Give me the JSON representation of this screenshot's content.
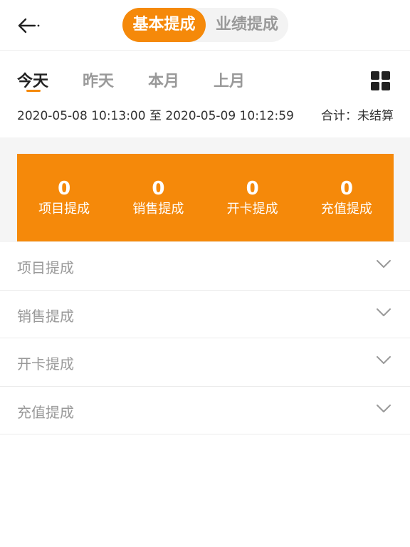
{
  "header": {
    "segment_active": "基本提成",
    "segment_inactive": "业绩提成"
  },
  "tabs": [
    "今天",
    "昨天",
    "本月",
    "上月"
  ],
  "date_range": "2020-05-08 10:13:00 至 2020-05-09 10:12:59",
  "total": "合计：未结算",
  "stats": [
    {
      "value": "0",
      "label": "项目提成"
    },
    {
      "value": "0",
      "label": "销售提成"
    },
    {
      "value": "0",
      "label": "开卡提成"
    },
    {
      "value": "0",
      "label": "充值提成"
    }
  ],
  "sections": [
    {
      "label": "项目提成"
    },
    {
      "label": "销售提成"
    },
    {
      "label": "开卡提成"
    },
    {
      "label": "充值提成"
    }
  ],
  "colors": {
    "accent": "#f5890a",
    "muted": "#999999"
  },
  "icons": {
    "back": "back-arrow-icon",
    "grid": "grid-icon",
    "chevron": "chevron-down-icon"
  }
}
